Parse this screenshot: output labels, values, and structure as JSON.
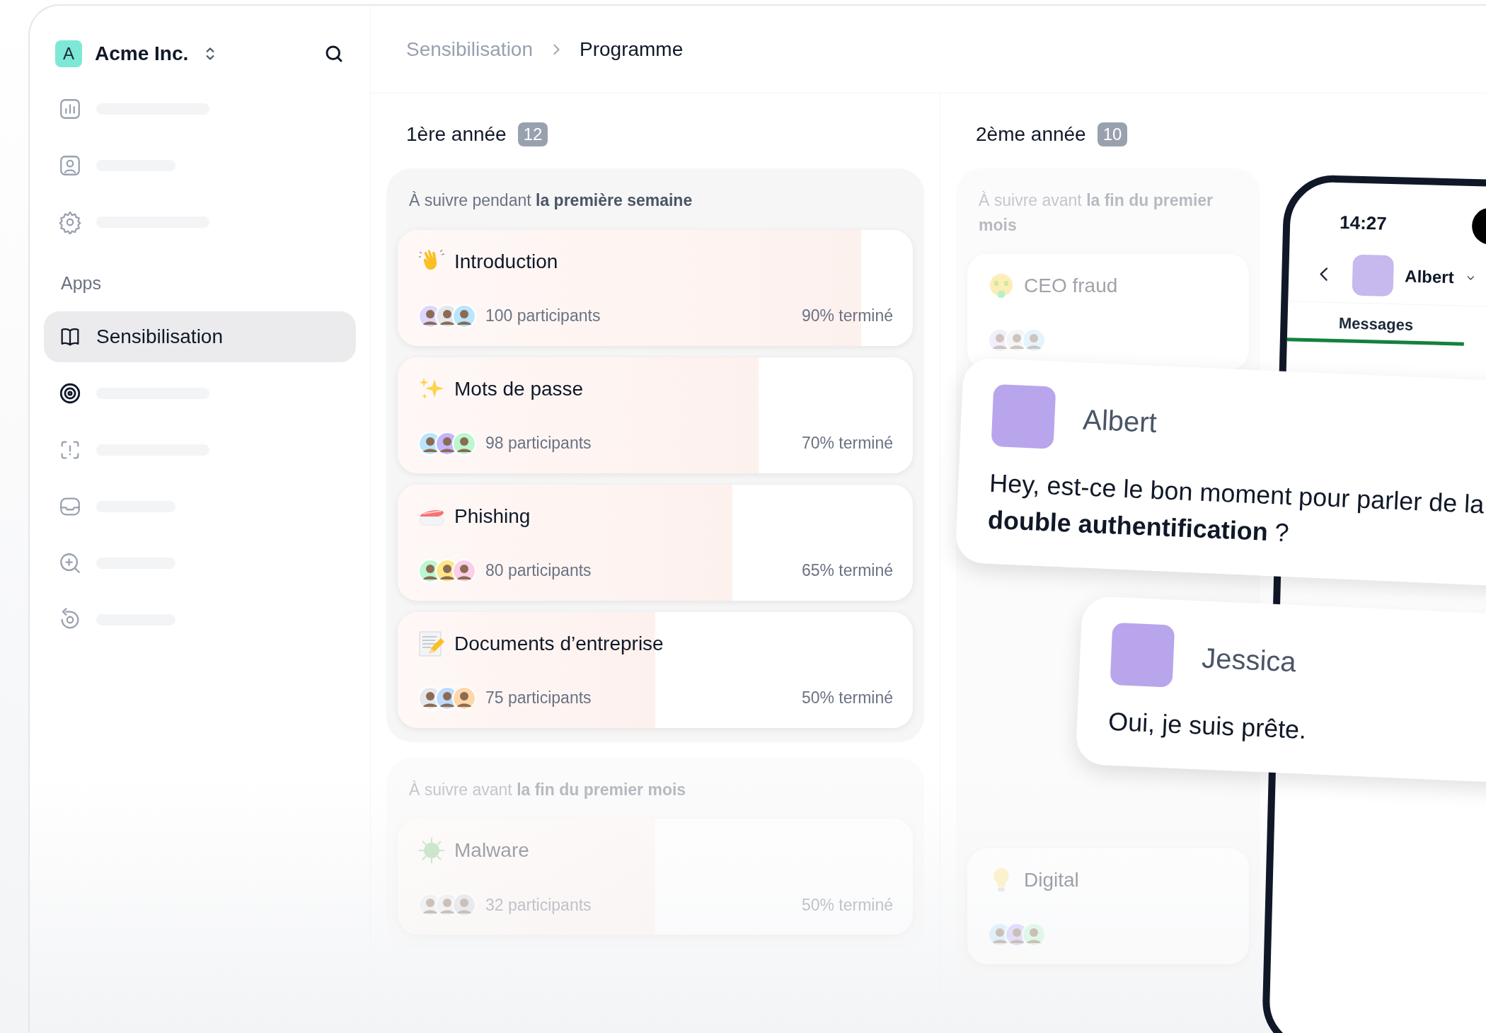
{
  "sidebar": {
    "workspace": {
      "initial": "A",
      "name": "Acme Inc."
    },
    "top_items": [
      {
        "kind": "skeleton",
        "selected": false
      },
      {
        "kind": "skeleton",
        "selected": false
      },
      {
        "kind": "skeleton",
        "selected": false
      }
    ],
    "section_label": "Apps",
    "app_items": [
      {
        "kind": "link",
        "label": "Sensibilisation",
        "selected": true
      },
      {
        "kind": "skeleton",
        "selected": false
      },
      {
        "kind": "skeleton",
        "selected": false
      },
      {
        "kind": "skeleton",
        "selected": false
      },
      {
        "kind": "skeleton",
        "selected": false
      },
      {
        "kind": "skeleton",
        "selected": false
      }
    ]
  },
  "breadcrumb": [
    {
      "label": "Sensibilisation",
      "selected": false
    },
    {
      "label": "Programme",
      "selected": true
    }
  ],
  "columns": [
    {
      "title": "1ère année",
      "count": "12",
      "groups": [
        {
          "label": "À suivre pendant **la première semaine**",
          "faded": false,
          "cards": [
            {
              "title": "Introduction",
              "participants": "100 participants",
              "progress": "90% terminé",
              "level": 0.9
            },
            {
              "title": "Mots de passe",
              "participants": "98 participants",
              "progress": "70% terminé",
              "level": 0.7
            },
            {
              "title": "Phishing",
              "participants": "80 participants",
              "progress": "65% terminé",
              "level": 0.65
            },
            {
              "title": "Documents d’entreprise",
              "participants": "75 participants",
              "progress": "50% terminé",
              "level": 0.5
            }
          ]
        },
        {
          "label": "À suivre avant **la fin du premier mois**",
          "faded": true,
          "cards": [
            {
              "title": "Malware",
              "participants": "32 participants",
              "progress": "50% terminé",
              "level": 0.5
            }
          ]
        }
      ]
    },
    {
      "title": "2ème année",
      "count": "10",
      "groups": [
        {
          "label": "À suivre avant **la fin du premier mois**",
          "faded": true,
          "cards": [
            {
              "title": "CEO fraud"
            },
            {
              "title": "Digital"
            }
          ]
        }
      ]
    }
  ],
  "phone": {
    "time": "14:27",
    "contact": "Albert",
    "tab": {
      "label": "Messages",
      "selected": true
    }
  },
  "messages": [
    {
      "author": "Albert",
      "text": "Hey, est-ce le bon moment pour parler de la **double authentification** ?"
    },
    {
      "author": "Jessica",
      "text": "Oui, je suis prête."
    }
  ]
}
